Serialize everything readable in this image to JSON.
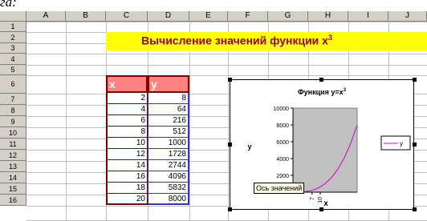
{
  "corner_text": "га:",
  "columns": [
    "A",
    "B",
    "C",
    "D",
    "E",
    "F",
    "G",
    "H",
    "I",
    "J"
  ],
  "rows": [
    "1",
    "2",
    "3",
    "4",
    "5",
    "6",
    "7",
    "8",
    "9",
    "10",
    "11",
    "12",
    "13",
    "14",
    "15",
    "16"
  ],
  "title": "Вычисление значений функции  x",
  "title_sup": "3",
  "table": {
    "x_header": "x",
    "y_header": "y",
    "x": [
      "2",
      "4",
      "6",
      "8",
      "10",
      "12",
      "14",
      "16",
      "18",
      "20"
    ],
    "y": [
      "8",
      "64",
      "216",
      "512",
      "1000",
      "1728",
      "2744",
      "4096",
      "5832",
      "8000"
    ]
  },
  "chart_data": {
    "type": "line",
    "title": "Функция y=x",
    "title_sup": "3",
    "xlabel": "x",
    "ylabel": "y",
    "ylim": [
      0,
      10000
    ],
    "yticks": [
      "10000",
      "8000",
      "6000",
      "4000",
      "2000"
    ],
    "xticks": [
      "7",
      "10"
    ],
    "series": [
      {
        "name": "y",
        "x": [
          2,
          4,
          6,
          8,
          10,
          12,
          14,
          16,
          18,
          20
        ],
        "values": [
          8,
          64,
          216,
          512,
          1000,
          1728,
          2744,
          4096,
          5832,
          8000
        ]
      }
    ],
    "legend": "right",
    "plot_bg": "#c0c0c0",
    "line_color": "#cc00cc"
  },
  "tooltip": "Ось значений",
  "colors": {
    "title_band": "#ffff00",
    "title_text": "#990033",
    "header_fill": "#ff8080",
    "border_dark": "#800000"
  }
}
